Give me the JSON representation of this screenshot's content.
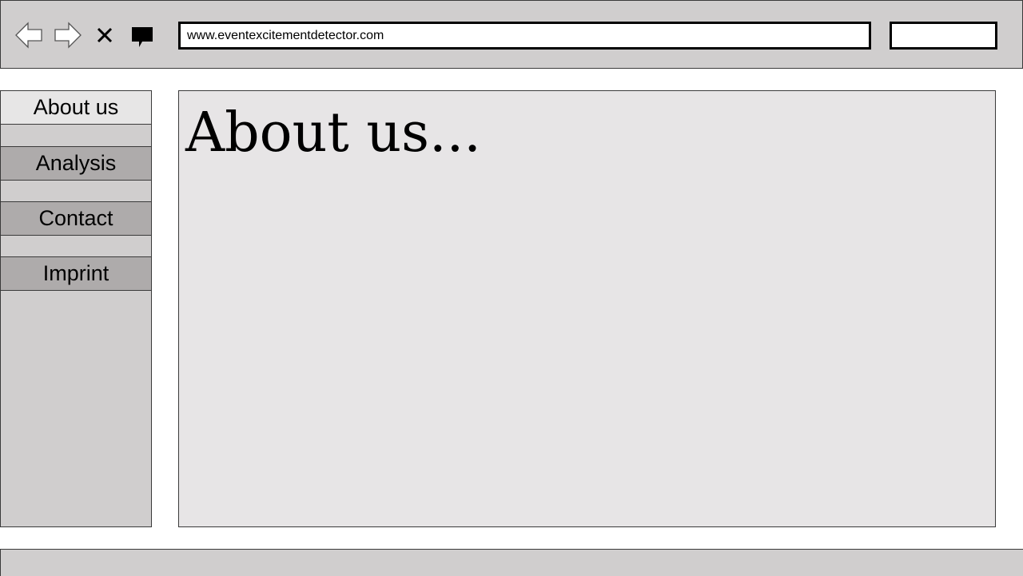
{
  "browser": {
    "url": "www.eventexcitementdetector.com",
    "search_value": "",
    "icons": [
      "back-arrow-icon",
      "forward-arrow-icon",
      "close-icon",
      "comment-icon"
    ]
  },
  "sidebar": {
    "items": [
      {
        "label": "About us",
        "active": true
      },
      {
        "label": "Analysis",
        "active": false
      },
      {
        "label": "Contact",
        "active": false
      },
      {
        "label": "Imprint",
        "active": false
      }
    ]
  },
  "main": {
    "title": "About us..."
  },
  "colors": {
    "chrome": "#d0cece",
    "menu_inactive": "#aeabab",
    "menu_active": "#e7e6e6",
    "content_bg": "#e7e5e6"
  }
}
